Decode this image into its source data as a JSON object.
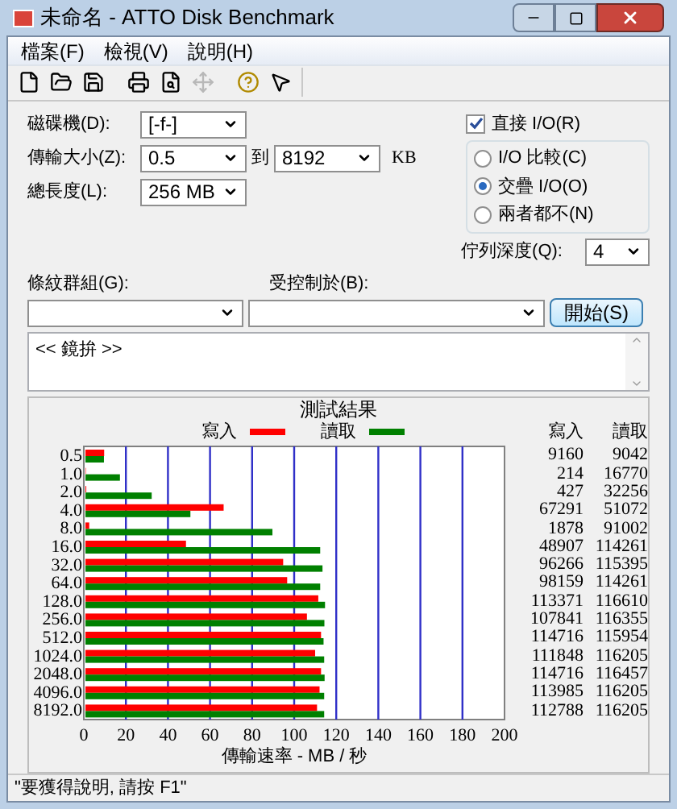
{
  "window": {
    "title": "未命名 - ATTO Disk Benchmark"
  },
  "menu": [
    {
      "label": "檔案(F)"
    },
    {
      "label": "檢視(V)"
    },
    {
      "label": "說明(H)"
    }
  ],
  "toolbar": [
    {
      "kind": "new",
      "disabled": false
    },
    {
      "kind": "open",
      "disabled": false
    },
    {
      "kind": "save",
      "disabled": false
    },
    {
      "kind": "print",
      "disabled": false
    },
    {
      "kind": "preview",
      "disabled": false
    },
    {
      "kind": "move",
      "disabled": true
    },
    {
      "kind": "help",
      "disabled": false
    },
    {
      "kind": "context-help",
      "disabled": false
    }
  ],
  "form": {
    "drive": {
      "label": "磁碟機(D):",
      "value": "[-f-]"
    },
    "transfer_size": {
      "label": "傳輸大小(Z):",
      "from": "0.5",
      "to_label": "到",
      "to": "8192",
      "unit": "KB"
    },
    "total_length": {
      "label": "總長度(L):",
      "value": "256 MB"
    },
    "direct_io": {
      "label": "直接 I/O(R)",
      "checked": true
    },
    "io_modes": [
      {
        "label": "I/O 比較(C)",
        "selected": false
      },
      {
        "label": "交疊 I/O(O)",
        "selected": true
      },
      {
        "label": "兩者都不(N)",
        "selected": false
      }
    ],
    "queue_depth": {
      "label": "佇列深度(Q):",
      "value": "4"
    },
    "stripe_group": {
      "label": "條紋群組(G):"
    },
    "controlled_by": {
      "label": "受控制於(B):"
    },
    "start_button": "開始(S)",
    "description": "<< 鏡拚 >>"
  },
  "results": {
    "title": "測試結果",
    "columns": [
      "寫入",
      "讀取"
    ],
    "rows": [
      {
        "write": "9160",
        "read": "9042"
      },
      {
        "write": "214",
        "read": "16770"
      },
      {
        "write": "427",
        "read": "32256"
      },
      {
        "write": "67291",
        "read": "51072"
      },
      {
        "write": "1878",
        "read": "91002"
      },
      {
        "write": "48907",
        "read": "114261"
      },
      {
        "write": "96266",
        "read": "115395"
      },
      {
        "write": "98159",
        "read": "114261"
      },
      {
        "write": "113371",
        "read": "116610"
      },
      {
        "write": "107841",
        "read": "116355"
      },
      {
        "write": "114716",
        "read": "115954"
      },
      {
        "write": "111848",
        "read": "116205"
      },
      {
        "write": "114716",
        "read": "116457"
      },
      {
        "write": "113985",
        "read": "116205"
      },
      {
        "write": "112788",
        "read": "116205"
      }
    ],
    "chart_data": {
      "type": "bar",
      "orientation": "horizontal",
      "grid": true,
      "xlabel": "傳輸速率 - MB / 秒",
      "categories": [
        "0.5",
        "1.0",
        "2.0",
        "4.0",
        "8.0",
        "16.0",
        "32.0",
        "64.0",
        "128.0",
        "256.0",
        "512.0",
        "1024.0",
        "2048.0",
        "4096.0",
        "8192.0"
      ],
      "xlim": [
        0,
        200
      ],
      "xticks": [
        0,
        20,
        40,
        60,
        80,
        100,
        120,
        140,
        160,
        180,
        200
      ],
      "series": [
        {
          "name": "寫入",
          "color": "#ff0000",
          "values": [
            8.9,
            0.2,
            0.4,
            65.7,
            1.8,
            47.8,
            94.0,
            95.9,
            110.7,
            105.3,
            112.0,
            109.2,
            112.0,
            111.3,
            110.1
          ]
        },
        {
          "name": "讀取",
          "color": "#008000",
          "values": [
            8.8,
            16.4,
            31.5,
            49.9,
            88.9,
            111.6,
            112.7,
            111.6,
            113.9,
            113.6,
            113.2,
            113.5,
            113.7,
            113.5,
            113.5
          ]
        }
      ]
    }
  },
  "status_bar": "\"要獲得說明, 請按 F1\""
}
